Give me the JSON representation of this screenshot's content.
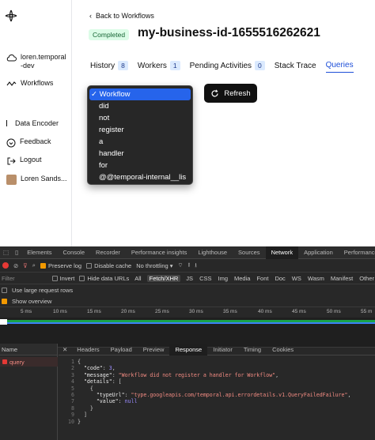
{
  "sidebar": {
    "namespace": "loren.temporal-dev",
    "workflows": "Workflows",
    "data_encoder": "Data Encoder",
    "feedback": "Feedback",
    "logout": "Logout",
    "user": "Loren Sands..."
  },
  "header": {
    "back": "Back to Workflows",
    "status": "Completed",
    "workflow_id": "my-business-id-1655516262621"
  },
  "tabs": [
    {
      "label": "History",
      "count": "8"
    },
    {
      "label": "Workers",
      "count": "1"
    },
    {
      "label": "Pending Activities",
      "count": "0"
    },
    {
      "label": "Stack Trace"
    },
    {
      "label": "Queries"
    }
  ],
  "query_select": {
    "options": [
      "Workflow",
      "did",
      "not",
      "register",
      "a",
      "handler",
      "for",
      "@@temporal-internal__lis"
    ],
    "selected": "Workflow"
  },
  "refresh_label": "Refresh",
  "devtools": {
    "panel_tabs": [
      "Elements",
      "Console",
      "Recorder",
      "Performance insights",
      "Lighthouse",
      "Sources",
      "Network",
      "Application",
      "Performance"
    ],
    "active_panel": "Network",
    "preserve_log": "Preserve log",
    "disable_cache": "Disable cache",
    "throttling": "No throttling",
    "filter_placeholder": "Filter",
    "invert": "Invert",
    "hide_data_urls": "Hide data URLs",
    "filter_types": [
      "All",
      "Fetch/XHR",
      "JS",
      "CSS",
      "Img",
      "Media",
      "Font",
      "Doc",
      "WS",
      "Wasm",
      "Manifest",
      "Other"
    ],
    "active_filter": "Fetch/XHR",
    "large_rows": "Use large request rows",
    "show_overview": "Show overview",
    "timeline": [
      "5 ms",
      "10 ms",
      "15 ms",
      "20 ms",
      "25 ms",
      "30 ms",
      "35 ms",
      "40 ms",
      "45 ms",
      "50 ms",
      "55 m"
    ],
    "name_header": "Name",
    "detail_tabs": [
      "Headers",
      "Payload",
      "Preview",
      "Response",
      "Initiator",
      "Timing",
      "Cookies"
    ],
    "active_detail": "Response",
    "request_name": "query",
    "response": {
      "code_key": "\"code\"",
      "code_val": "3",
      "message_key": "\"message\"",
      "message_val": "\"Workflow did not register a handler for Workflow\"",
      "details_key": "\"details\"",
      "type_key": "\"typeUrl\"",
      "type_val": "\"type.googleapis.com/temporal.api.errordetails.v1.QueryFailedFailure\"",
      "value_key": "\"value\"",
      "value_val": "null"
    }
  }
}
